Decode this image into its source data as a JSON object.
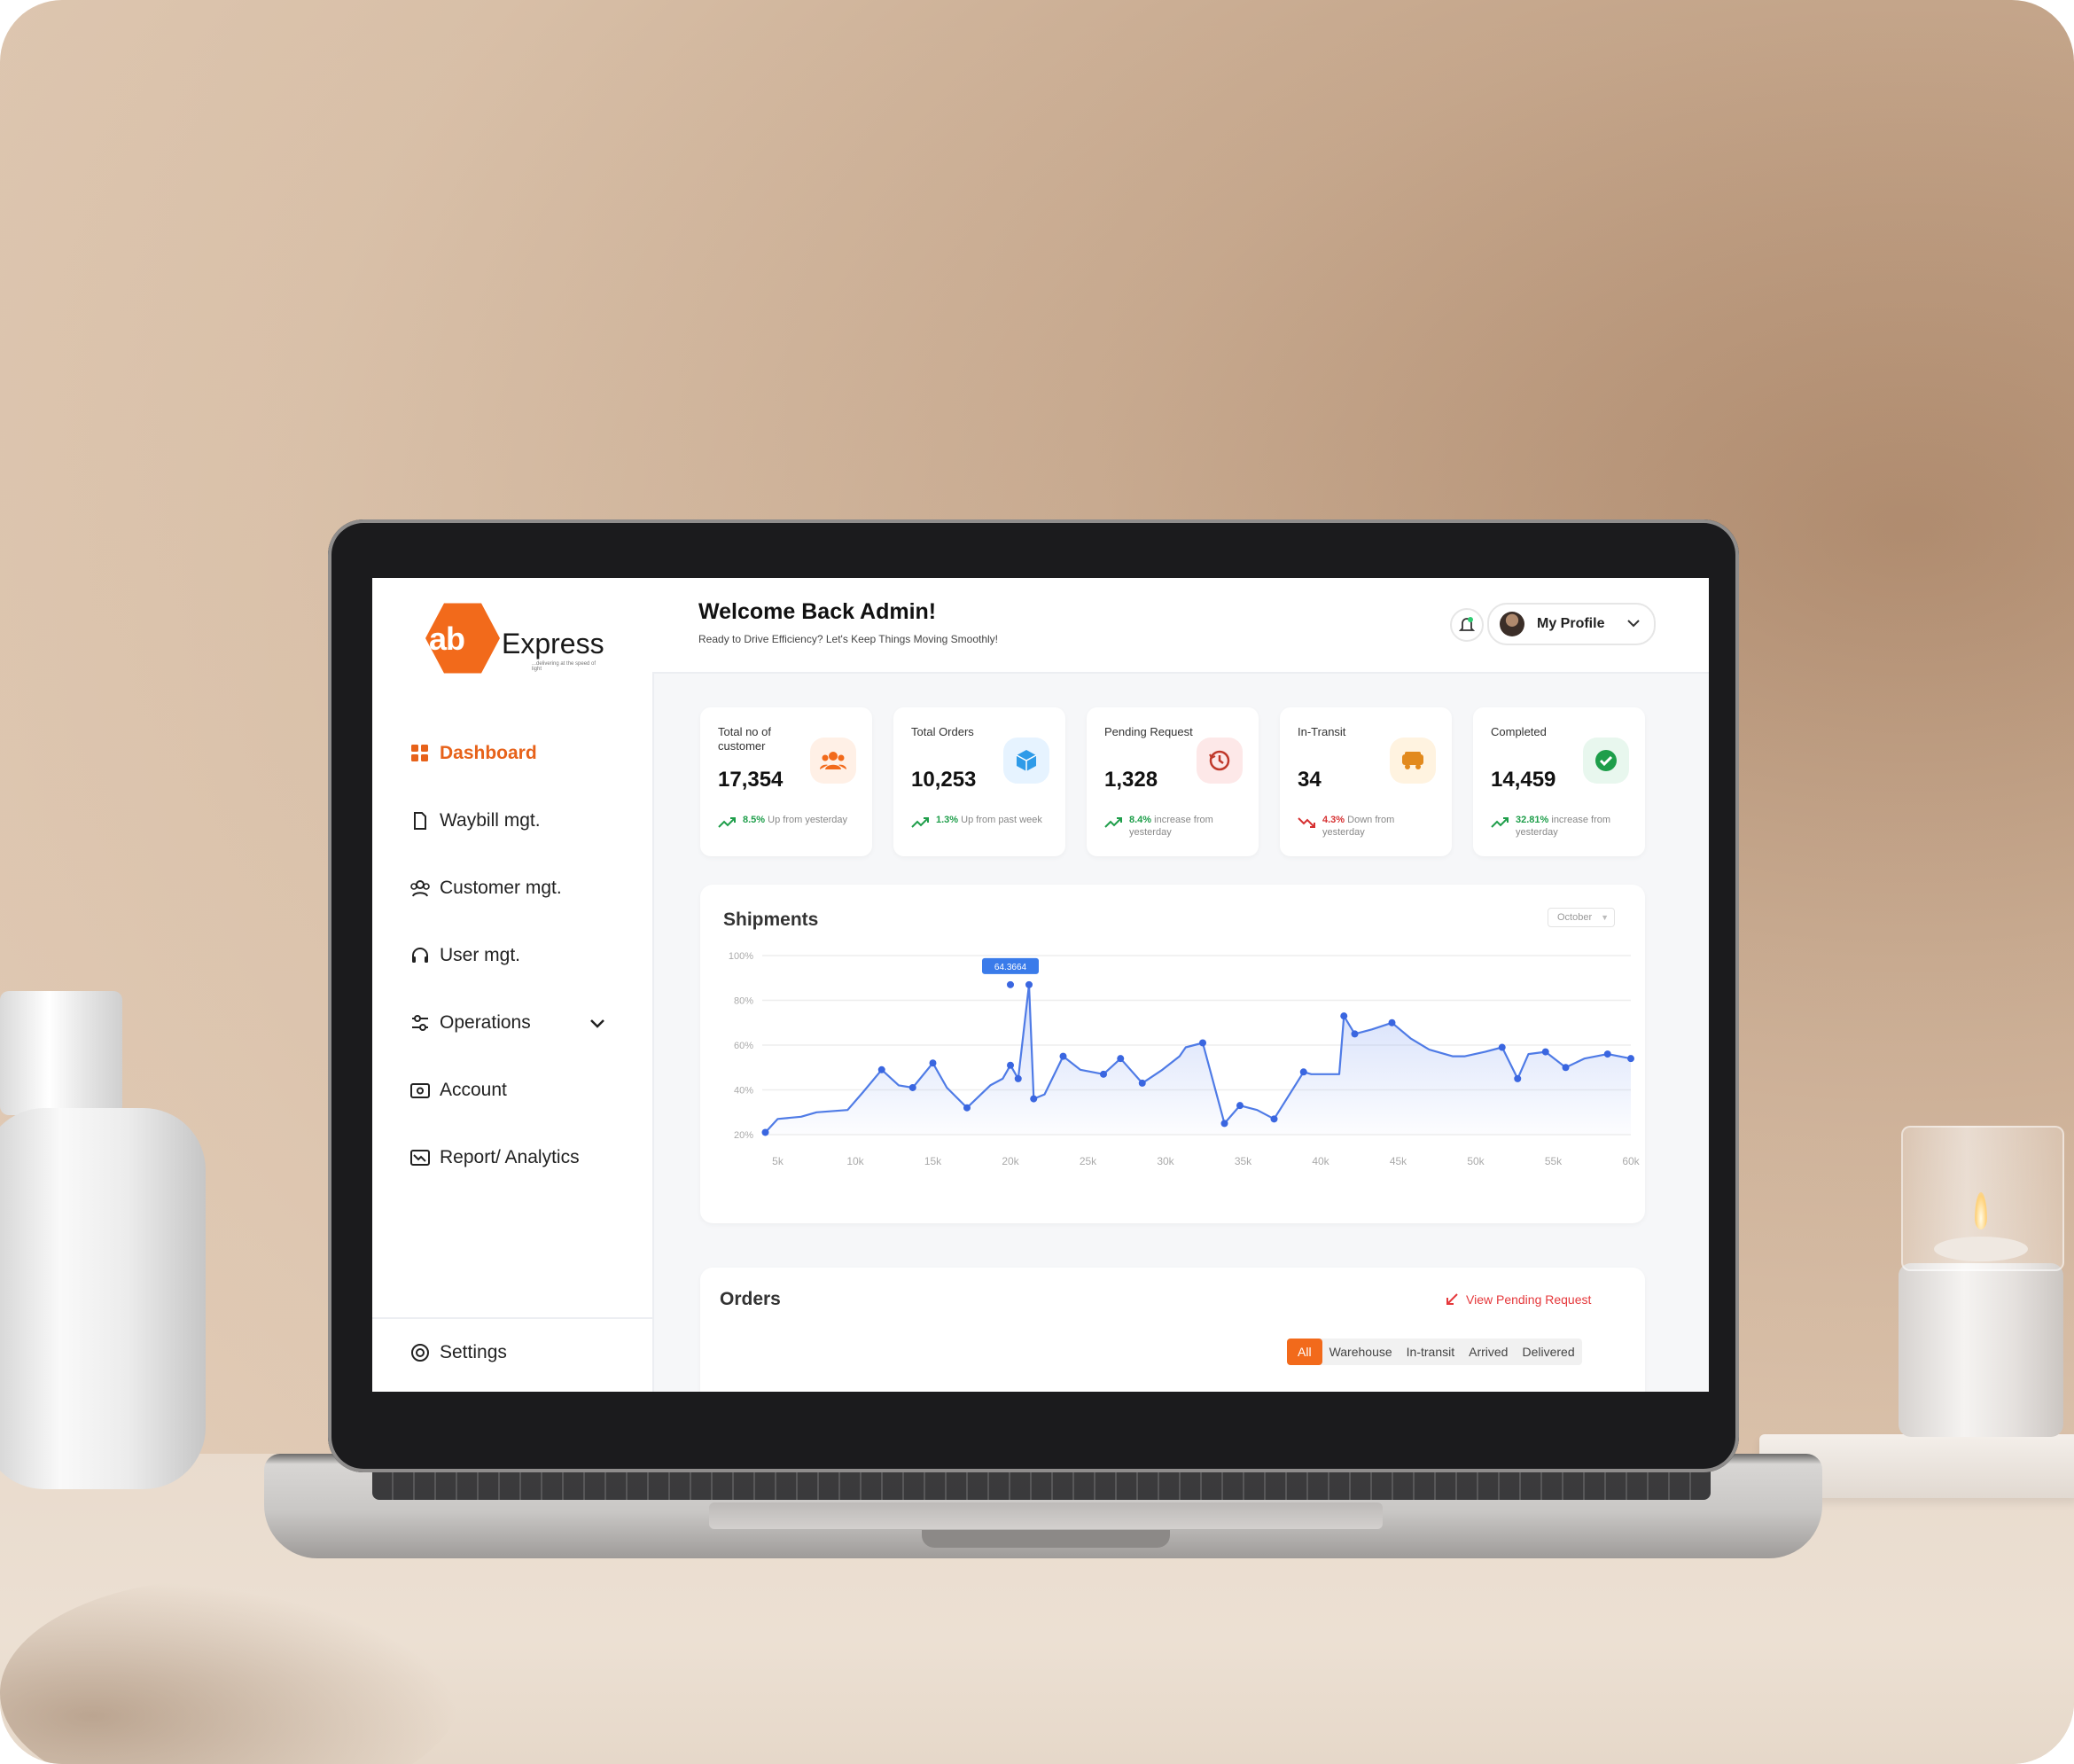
{
  "brand": {
    "logo_mark": "ab",
    "name": "Express",
    "tagline": "...delivering at the speed of light",
    "accent": "#f26a1b"
  },
  "sidebar": {
    "items": [
      {
        "label": "Dashboard",
        "icon": "grid-icon",
        "active": true
      },
      {
        "label": "Waybill mgt.",
        "icon": "document-icon"
      },
      {
        "label": "Customer mgt.",
        "icon": "users-icon"
      },
      {
        "label": "User mgt.",
        "icon": "headset-icon"
      },
      {
        "label": "Operations",
        "icon": "sliders-icon"
      },
      {
        "label": "Account",
        "icon": "wallet-icon"
      },
      {
        "label": "Report/ Analytics",
        "icon": "chart-icon"
      }
    ],
    "settings_label": "Settings"
  },
  "header": {
    "welcome": "Welcome Back Admin!",
    "subtitle": "Ready to Drive Efficiency? Let's Keep Things Moving Smoothly!",
    "profile_label": "My Profile"
  },
  "cards": [
    {
      "title": "Total no of customer",
      "value": "17,354",
      "change_value": "8.5%",
      "change_text": "Up from yesterday",
      "trend": "up",
      "icon": "users-icon",
      "icon_bg": "#fff0e6",
      "icon_color": "#f26a1b"
    },
    {
      "title": "Total Orders",
      "value": "10,253",
      "change_value": "1.3%",
      "change_text": "Up from past week",
      "trend": "up",
      "icon": "box-icon",
      "icon_bg": "#e6f3ff",
      "icon_color": "#2f9be8"
    },
    {
      "title": "Pending Request",
      "value": "1,328",
      "change_value": "8.4%",
      "change_text": "increase from yesterday",
      "trend": "up",
      "icon": "clock-icon",
      "icon_bg": "#fde8e8",
      "icon_color": "#c0392b"
    },
    {
      "title": "In-Transit",
      "value": "34",
      "change_value": "4.3%",
      "change_text": "Down from yesterday",
      "trend": "down",
      "icon": "truck-icon",
      "icon_bg": "#fff3e0",
      "icon_color": "#e28a1e"
    },
    {
      "title": "Completed",
      "value": "14,459",
      "change_value": "32.81%",
      "change_text": "increase from yesterday",
      "trend": "up",
      "icon": "check-icon",
      "icon_bg": "#e8f7ee",
      "icon_color": "#1e9e4a"
    }
  ],
  "shipments": {
    "title": "Shipments",
    "month": "October"
  },
  "chart_data": {
    "type": "area",
    "title": "Shipments",
    "x_ticks": [
      "5k",
      "10k",
      "15k",
      "20k",
      "25k",
      "30k",
      "35k",
      "40k",
      "45k",
      "50k",
      "55k",
      "60k"
    ],
    "y_ticks": [
      "20%",
      "40%",
      "60%",
      "80%",
      "100%"
    ],
    "xlim": [
      4000,
      60000
    ],
    "ylim": [
      20,
      100
    ],
    "highlight": {
      "x": 20000,
      "y": 87,
      "label": "64.3664"
    },
    "x": [
      4200,
      5000,
      6500,
      7500,
      9500,
      10500,
      11700,
      12800,
      13700,
      15000,
      15900,
      17200,
      18700,
      19500,
      20000,
      20500,
      21200,
      21500,
      22200,
      23400,
      24500,
      26000,
      27100,
      28500,
      29800,
      30900,
      31300,
      32400,
      33800,
      34800,
      35900,
      37000,
      38900,
      39400,
      40200,
      41200,
      41500,
      42200,
      43300,
      44600,
      45800,
      47000,
      48500,
      49300,
      50600,
      51700,
      52700,
      53400,
      54500,
      55800,
      57000,
      58500,
      60000
    ],
    "y": [
      21,
      27,
      28,
      30,
      31,
      39,
      49,
      42,
      41,
      52,
      41,
      32,
      42,
      45,
      51,
      45,
      87,
      36,
      38,
      55,
      49,
      47,
      54,
      43,
      49,
      55,
      59,
      61,
      25,
      33,
      31,
      27,
      48,
      47,
      47,
      47,
      73,
      65,
      67,
      70,
      63,
      58,
      55,
      55,
      57,
      59,
      45,
      56,
      57,
      50,
      54,
      56,
      54
    ]
  },
  "orders": {
    "title": "Orders",
    "link_label": "View Pending Request",
    "tabs": [
      "All",
      "Warehouse",
      "In-transit",
      "Arrived",
      "Delivered"
    ],
    "active_tab": "All"
  }
}
